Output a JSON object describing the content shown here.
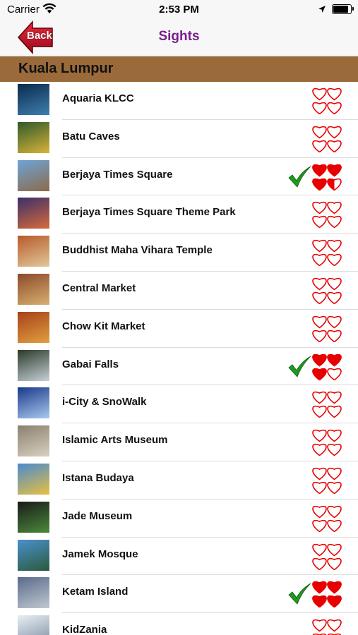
{
  "status_bar": {
    "carrier": "Carrier",
    "time": "2:53 PM"
  },
  "nav": {
    "back_label": "Back",
    "title": "Sights"
  },
  "section": {
    "title": "Kuala Lumpur"
  },
  "colors": {
    "title": "#7a1f8c",
    "section_bg": "#9b6a3a",
    "heart": "#e80000",
    "check": "#1f9a1f",
    "back_arrow": "#c8102e"
  },
  "items": [
    {
      "name": "Aquaria KLCC",
      "visited": false,
      "rating": 0,
      "thumb": [
        "#0b2a4a",
        "#3f7fb0"
      ]
    },
    {
      "name": "Batu Caves",
      "visited": false,
      "rating": 0,
      "thumb": [
        "#2f5a2a",
        "#d9b23a"
      ]
    },
    {
      "name": "Berjaya Times Square",
      "visited": true,
      "rating": 3.5,
      "thumb": [
        "#6fa3d8",
        "#8a6b4a"
      ]
    },
    {
      "name": "Berjaya Times Square Theme Park",
      "visited": false,
      "rating": 0,
      "thumb": [
        "#3a2f6a",
        "#d86a3a"
      ]
    },
    {
      "name": "Buddhist Maha Vihara Temple",
      "visited": false,
      "rating": 0,
      "thumb": [
        "#b85a2a",
        "#e0c89a"
      ]
    },
    {
      "name": "Central Market",
      "visited": false,
      "rating": 0,
      "thumb": [
        "#8a4a2a",
        "#d8b070"
      ]
    },
    {
      "name": "Chow Kit Market",
      "visited": false,
      "rating": 0,
      "thumb": [
        "#a8401a",
        "#e0a040"
      ]
    },
    {
      "name": "Gabai Falls",
      "visited": true,
      "rating": 3,
      "thumb": [
        "#2a3a2a",
        "#c8d0d8"
      ]
    },
    {
      "name": "i-City & SnoWalk",
      "visited": false,
      "rating": 0,
      "thumb": [
        "#1a3a8a",
        "#a8c8f0"
      ]
    },
    {
      "name": "Islamic Arts Museum",
      "visited": false,
      "rating": 0,
      "thumb": [
        "#8a8070",
        "#d8d0c0"
      ]
    },
    {
      "name": "Istana Budaya",
      "visited": false,
      "rating": 0,
      "thumb": [
        "#4a8ad0",
        "#e8c040"
      ]
    },
    {
      "name": "Jade Museum",
      "visited": false,
      "rating": 0,
      "thumb": [
        "#1a1a1a",
        "#4a8a3a"
      ]
    },
    {
      "name": "Jamek Mosque",
      "visited": false,
      "rating": 0,
      "thumb": [
        "#4a90d0",
        "#2a5a3a"
      ]
    },
    {
      "name": "Ketam Island",
      "visited": true,
      "rating": 4,
      "thumb": [
        "#5a6a8a",
        "#c0c8d0"
      ]
    },
    {
      "name": "KidZania",
      "visited": false,
      "rating": 0,
      "thumb": [
        "#e8eef4",
        "#7a8aa0"
      ]
    }
  ]
}
